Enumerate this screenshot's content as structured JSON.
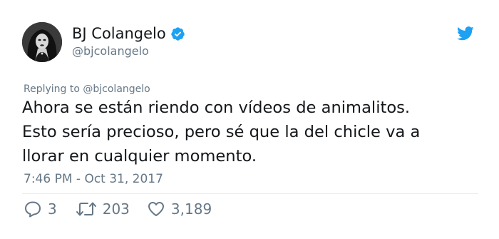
{
  "author": {
    "display_name": "BJ Colangelo",
    "handle": "@bjcolangelo",
    "verified": true,
    "avatar_icon": "user-avatar-photo"
  },
  "header": {
    "brand_icon": "twitter-bird-icon",
    "brand_color": "#1da1f2"
  },
  "tweet": {
    "replying_prefix": "Replying to ",
    "replying_to": "@bjcolangelo",
    "text": "Ahora se están riendo con vídeos de animalitos.\nEsto sería precioso, pero sé que la del chicle va a\nllorar en cualquier momento.",
    "timestamp": "7:46 PM - Oct 31, 2017"
  },
  "actions": {
    "replies": "3",
    "retweets": "203",
    "likes": "3,189"
  },
  "colors": {
    "text_primary": "#14171a",
    "text_secondary": "#657786",
    "verified_badge": "#1da1f2",
    "divider": "#e6ecf0"
  }
}
